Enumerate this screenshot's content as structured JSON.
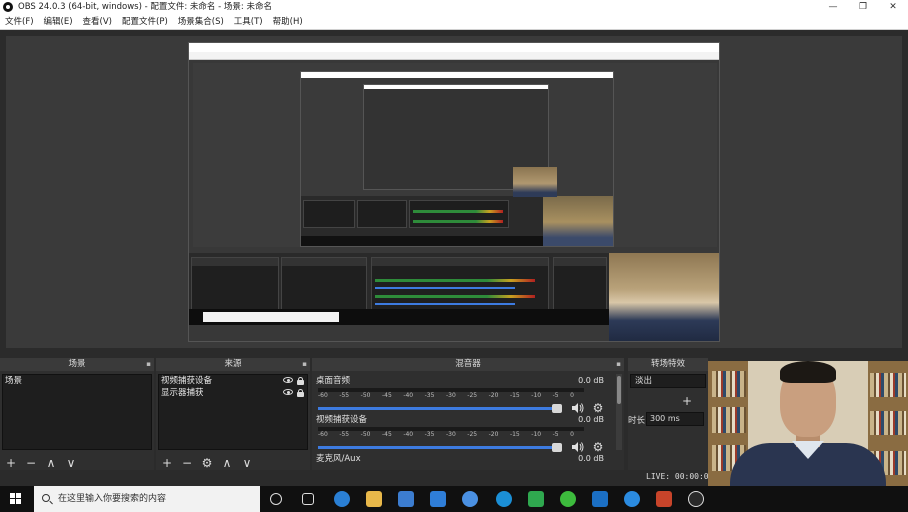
{
  "window": {
    "title": "OBS 24.0.3 (64-bit, windows) - 配置文件: 未命名 - 场景: 未命名",
    "controls": {
      "minimize": "—",
      "maximize": "❐",
      "close": "✕"
    }
  },
  "menubar": {
    "items": [
      "文件(F)",
      "编辑(E)",
      "查看(V)",
      "配置文件(P)",
      "场景集合(S)",
      "工具(T)",
      "帮助(H)"
    ]
  },
  "docks": {
    "scenes": {
      "title": "场景",
      "items": [
        "场景"
      ]
    },
    "sources": {
      "title": "来源",
      "items": [
        "视频捕获设备",
        "显示器捕获"
      ]
    },
    "mixer": {
      "title": "混音器",
      "tracks": [
        {
          "name": "桌面音频",
          "db": "0.0 dB",
          "level": 0.0,
          "volume": 0.93
        },
        {
          "name": "视频捕获设备",
          "db": "0.0 dB",
          "level": 0.0,
          "volume": 0.93
        },
        {
          "name": "麦克风/Aux",
          "db": "0.0 dB",
          "level": 0.0,
          "volume": 0.93
        }
      ],
      "scale": [
        "-60",
        "-55",
        "-50",
        "-45",
        "-40",
        "-35",
        "-30",
        "-25",
        "-20",
        "-15",
        "-10",
        "-5",
        "0"
      ]
    },
    "transitions": {
      "title": "转场特效",
      "selected": "淡出",
      "duration_label": "时长",
      "duration_value": "300 ms"
    }
  },
  "status": {
    "live": "LIVE: 00:00:00"
  },
  "taskbar": {
    "search_placeholder": "在这里输入你要搜索的内容",
    "icons": [
      {
        "name": "cortana-icon",
        "color": "#101010"
      },
      {
        "name": "task-view-icon",
        "color": "#101010"
      },
      {
        "name": "edge-icon",
        "color": "#2a7fd4"
      },
      {
        "name": "file-explorer-icon",
        "color": "#e8b84a"
      },
      {
        "name": "store-icon",
        "color": "#3c7dd0"
      },
      {
        "name": "mail-icon",
        "color": "#2f7ed8"
      },
      {
        "name": "chrome-icon",
        "color": "#4a90e2"
      },
      {
        "name": "edge-new-icon",
        "color": "#1b8fd6"
      },
      {
        "name": "media-player-icon",
        "color": "#2fa84f"
      },
      {
        "name": "wechat-icon",
        "color": "#3dbb3d"
      },
      {
        "name": "star-app-icon",
        "color": "#1b6fc4"
      },
      {
        "name": "feishu-icon",
        "color": "#2b8be0"
      },
      {
        "name": "powerpoint-icon",
        "color": "#c8442a"
      },
      {
        "name": "obs-icon",
        "color": "#2a2a2a"
      }
    ]
  }
}
